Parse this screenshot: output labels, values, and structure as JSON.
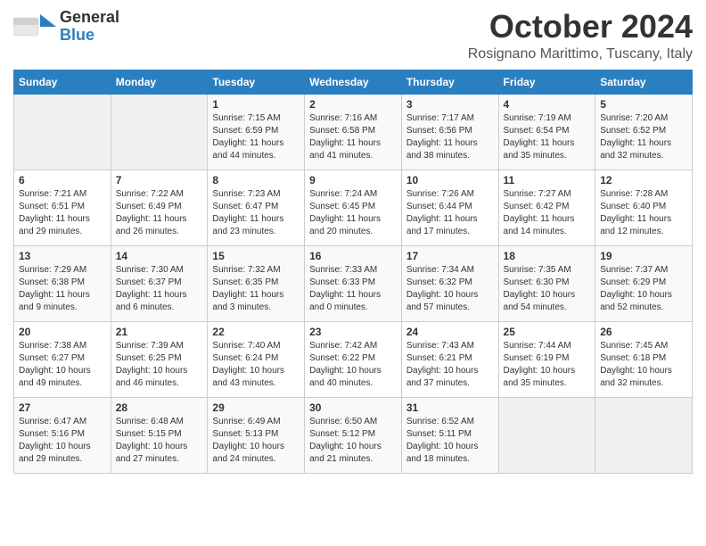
{
  "header": {
    "logo_general": "General",
    "logo_blue": "Blue",
    "month": "October 2024",
    "location": "Rosignano Marittimo, Tuscany, Italy"
  },
  "days_of_week": [
    "Sunday",
    "Monday",
    "Tuesday",
    "Wednesday",
    "Thursday",
    "Friday",
    "Saturday"
  ],
  "weeks": [
    [
      {
        "day": "",
        "sunrise": "",
        "sunset": "",
        "daylight": ""
      },
      {
        "day": "",
        "sunrise": "",
        "sunset": "",
        "daylight": ""
      },
      {
        "day": "1",
        "sunrise": "Sunrise: 7:15 AM",
        "sunset": "Sunset: 6:59 PM",
        "daylight": "Daylight: 11 hours and 44 minutes."
      },
      {
        "day": "2",
        "sunrise": "Sunrise: 7:16 AM",
        "sunset": "Sunset: 6:58 PM",
        "daylight": "Daylight: 11 hours and 41 minutes."
      },
      {
        "day": "3",
        "sunrise": "Sunrise: 7:17 AM",
        "sunset": "Sunset: 6:56 PM",
        "daylight": "Daylight: 11 hours and 38 minutes."
      },
      {
        "day": "4",
        "sunrise": "Sunrise: 7:19 AM",
        "sunset": "Sunset: 6:54 PM",
        "daylight": "Daylight: 11 hours and 35 minutes."
      },
      {
        "day": "5",
        "sunrise": "Sunrise: 7:20 AM",
        "sunset": "Sunset: 6:52 PM",
        "daylight": "Daylight: 11 hours and 32 minutes."
      }
    ],
    [
      {
        "day": "6",
        "sunrise": "Sunrise: 7:21 AM",
        "sunset": "Sunset: 6:51 PM",
        "daylight": "Daylight: 11 hours and 29 minutes."
      },
      {
        "day": "7",
        "sunrise": "Sunrise: 7:22 AM",
        "sunset": "Sunset: 6:49 PM",
        "daylight": "Daylight: 11 hours and 26 minutes."
      },
      {
        "day": "8",
        "sunrise": "Sunrise: 7:23 AM",
        "sunset": "Sunset: 6:47 PM",
        "daylight": "Daylight: 11 hours and 23 minutes."
      },
      {
        "day": "9",
        "sunrise": "Sunrise: 7:24 AM",
        "sunset": "Sunset: 6:45 PM",
        "daylight": "Daylight: 11 hours and 20 minutes."
      },
      {
        "day": "10",
        "sunrise": "Sunrise: 7:26 AM",
        "sunset": "Sunset: 6:44 PM",
        "daylight": "Daylight: 11 hours and 17 minutes."
      },
      {
        "day": "11",
        "sunrise": "Sunrise: 7:27 AM",
        "sunset": "Sunset: 6:42 PM",
        "daylight": "Daylight: 11 hours and 14 minutes."
      },
      {
        "day": "12",
        "sunrise": "Sunrise: 7:28 AM",
        "sunset": "Sunset: 6:40 PM",
        "daylight": "Daylight: 11 hours and 12 minutes."
      }
    ],
    [
      {
        "day": "13",
        "sunrise": "Sunrise: 7:29 AM",
        "sunset": "Sunset: 6:38 PM",
        "daylight": "Daylight: 11 hours and 9 minutes."
      },
      {
        "day": "14",
        "sunrise": "Sunrise: 7:30 AM",
        "sunset": "Sunset: 6:37 PM",
        "daylight": "Daylight: 11 hours and 6 minutes."
      },
      {
        "day": "15",
        "sunrise": "Sunrise: 7:32 AM",
        "sunset": "Sunset: 6:35 PM",
        "daylight": "Daylight: 11 hours and 3 minutes."
      },
      {
        "day": "16",
        "sunrise": "Sunrise: 7:33 AM",
        "sunset": "Sunset: 6:33 PM",
        "daylight": "Daylight: 11 hours and 0 minutes."
      },
      {
        "day": "17",
        "sunrise": "Sunrise: 7:34 AM",
        "sunset": "Sunset: 6:32 PM",
        "daylight": "Daylight: 10 hours and 57 minutes."
      },
      {
        "day": "18",
        "sunrise": "Sunrise: 7:35 AM",
        "sunset": "Sunset: 6:30 PM",
        "daylight": "Daylight: 10 hours and 54 minutes."
      },
      {
        "day": "19",
        "sunrise": "Sunrise: 7:37 AM",
        "sunset": "Sunset: 6:29 PM",
        "daylight": "Daylight: 10 hours and 52 minutes."
      }
    ],
    [
      {
        "day": "20",
        "sunrise": "Sunrise: 7:38 AM",
        "sunset": "Sunset: 6:27 PM",
        "daylight": "Daylight: 10 hours and 49 minutes."
      },
      {
        "day": "21",
        "sunrise": "Sunrise: 7:39 AM",
        "sunset": "Sunset: 6:25 PM",
        "daylight": "Daylight: 10 hours and 46 minutes."
      },
      {
        "day": "22",
        "sunrise": "Sunrise: 7:40 AM",
        "sunset": "Sunset: 6:24 PM",
        "daylight": "Daylight: 10 hours and 43 minutes."
      },
      {
        "day": "23",
        "sunrise": "Sunrise: 7:42 AM",
        "sunset": "Sunset: 6:22 PM",
        "daylight": "Daylight: 10 hours and 40 minutes."
      },
      {
        "day": "24",
        "sunrise": "Sunrise: 7:43 AM",
        "sunset": "Sunset: 6:21 PM",
        "daylight": "Daylight: 10 hours and 37 minutes."
      },
      {
        "day": "25",
        "sunrise": "Sunrise: 7:44 AM",
        "sunset": "Sunset: 6:19 PM",
        "daylight": "Daylight: 10 hours and 35 minutes."
      },
      {
        "day": "26",
        "sunrise": "Sunrise: 7:45 AM",
        "sunset": "Sunset: 6:18 PM",
        "daylight": "Daylight: 10 hours and 32 minutes."
      }
    ],
    [
      {
        "day": "27",
        "sunrise": "Sunrise: 6:47 AM",
        "sunset": "Sunset: 5:16 PM",
        "daylight": "Daylight: 10 hours and 29 minutes."
      },
      {
        "day": "28",
        "sunrise": "Sunrise: 6:48 AM",
        "sunset": "Sunset: 5:15 PM",
        "daylight": "Daylight: 10 hours and 27 minutes."
      },
      {
        "day": "29",
        "sunrise": "Sunrise: 6:49 AM",
        "sunset": "Sunset: 5:13 PM",
        "daylight": "Daylight: 10 hours and 24 minutes."
      },
      {
        "day": "30",
        "sunrise": "Sunrise: 6:50 AM",
        "sunset": "Sunset: 5:12 PM",
        "daylight": "Daylight: 10 hours and 21 minutes."
      },
      {
        "day": "31",
        "sunrise": "Sunrise: 6:52 AM",
        "sunset": "Sunset: 5:11 PM",
        "daylight": "Daylight: 10 hours and 18 minutes."
      },
      {
        "day": "",
        "sunrise": "",
        "sunset": "",
        "daylight": ""
      },
      {
        "day": "",
        "sunrise": "",
        "sunset": "",
        "daylight": ""
      }
    ]
  ]
}
